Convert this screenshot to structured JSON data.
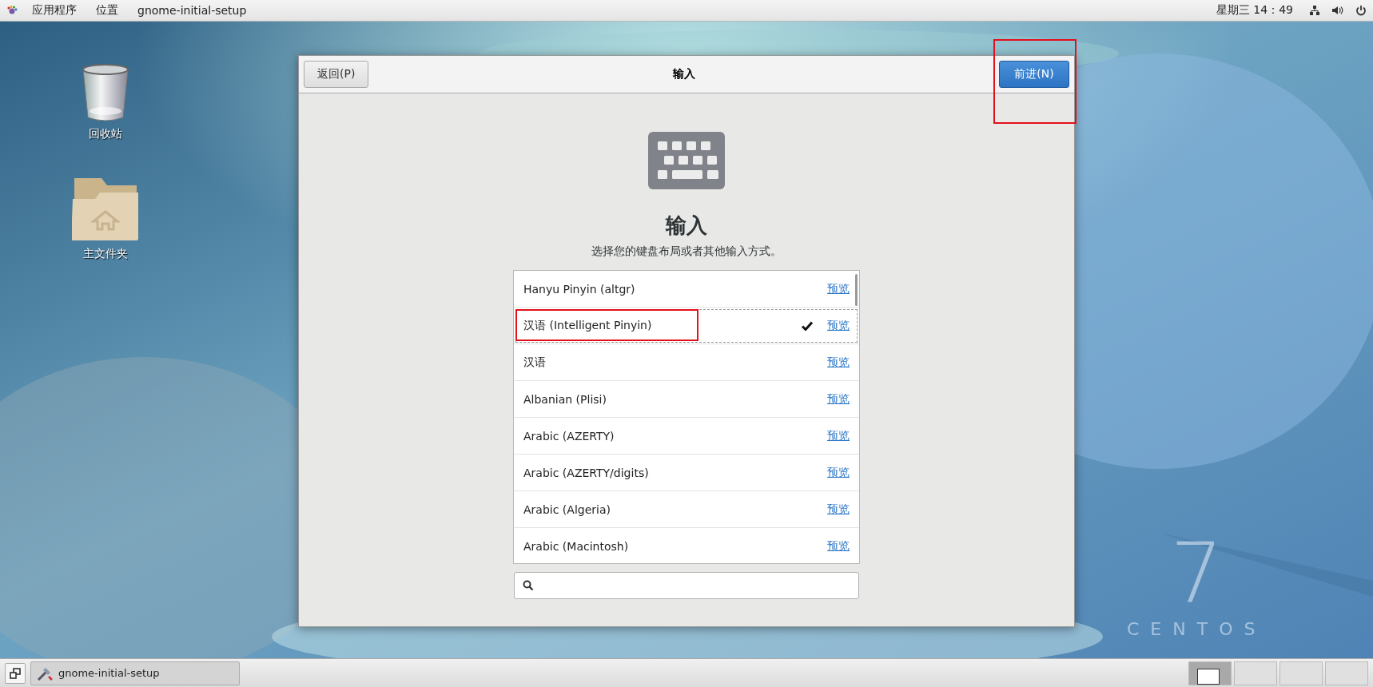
{
  "top_bar": {
    "menus": [
      "应用程序",
      "位置",
      "gnome-initial-setup"
    ],
    "clock": "星期三 14：49"
  },
  "desktop_icons": [
    {
      "kind": "trash",
      "label": "回收站"
    },
    {
      "kind": "folder",
      "label": "主文件夹"
    }
  ],
  "dialog": {
    "title": "输入",
    "back_button": "返回(P)",
    "next_button": {
      "label": "前进(N)",
      "annotated": true
    },
    "heading": "输入",
    "subtitle": "选择您的键盘布局或者其他输入方式。",
    "layouts": [
      {
        "name": "Hanyu Pinyin (altgr)",
        "checked": false,
        "selected": false,
        "annotated": false,
        "preview": "预览"
      },
      {
        "name": "汉语 (Intelligent Pinyin)",
        "checked": true,
        "selected": true,
        "annotated": true,
        "preview": "预览"
      },
      {
        "name": "汉语",
        "checked": false,
        "selected": false,
        "annotated": false,
        "preview": "预览"
      },
      {
        "name": "Albanian (Plisi)",
        "checked": false,
        "selected": false,
        "annotated": false,
        "preview": "预览"
      },
      {
        "name": "Arabic (AZERTY)",
        "checked": false,
        "selected": false,
        "annotated": false,
        "preview": "预览"
      },
      {
        "name": "Arabic (AZERTY/digits)",
        "checked": false,
        "selected": false,
        "annotated": false,
        "preview": "预览"
      },
      {
        "name": "Arabic (Algeria)",
        "checked": false,
        "selected": false,
        "annotated": false,
        "preview": "预览"
      },
      {
        "name": "Arabic (Macintosh)",
        "checked": false,
        "selected": false,
        "annotated": false,
        "preview": "预览"
      }
    ]
  },
  "wallpaper_logo": {
    "number": "7",
    "name": "CENTOS"
  },
  "taskbar": {
    "window_button": "gnome-initial-setup",
    "workspaces": [
      {
        "selected": true
      },
      {
        "selected": false
      },
      {
        "selected": false
      },
      {
        "selected": false
      }
    ]
  }
}
